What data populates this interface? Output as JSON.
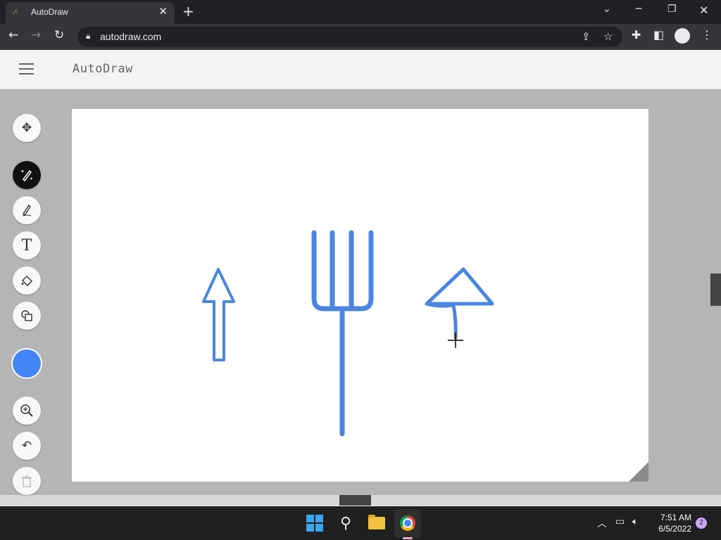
{
  "browser": {
    "tab_title": "AutoDraw",
    "tab_favicon": "autodraw-favicon",
    "url": "autodraw.com",
    "icons": [
      "minimize-icon",
      "restore-icon",
      "close-icon",
      "back-icon",
      "forward-icon",
      "reload-icon",
      "lock-icon",
      "share-icon",
      "star-icon",
      "extensions-icon",
      "sidepanel-icon",
      "profile-icon",
      "menu-icon"
    ]
  },
  "app": {
    "title": "AutoDraw",
    "tools": [
      {
        "name": "select-move-tool",
        "icon": "move-icon",
        "active": false
      },
      {
        "name": "autodraw-tool",
        "icon": "magic-pen-icon",
        "active": true
      },
      {
        "name": "draw-tool",
        "icon": "pen-icon",
        "active": false
      },
      {
        "name": "type-tool",
        "icon": "text-icon",
        "active": false
      },
      {
        "name": "fill-tool",
        "icon": "paint-bucket-icon",
        "active": false
      },
      {
        "name": "shape-tool",
        "icon": "shapes-icon",
        "active": false
      },
      {
        "name": "zoom-tool",
        "icon": "zoom-icon",
        "active": false
      },
      {
        "name": "undo-tool",
        "icon": "undo-icon",
        "active": false
      },
      {
        "name": "delete-tool",
        "icon": "trash-icon",
        "active": false,
        "disabled": true
      }
    ],
    "selected_color": "#4285f4",
    "stroke_color": "#4a86e0"
  },
  "taskbar": {
    "apps": [
      "windows-start-icon",
      "search-icon",
      "file-explorer-icon",
      "chrome-icon"
    ],
    "time": "7:51 AM",
    "date": "6/5/2022",
    "notification_count": "2"
  }
}
